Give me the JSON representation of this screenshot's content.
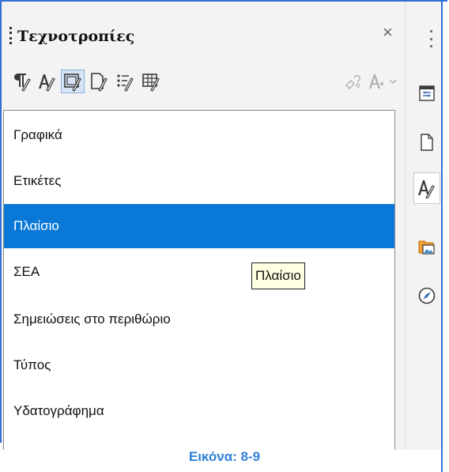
{
  "panel": {
    "title": "Τεχνοτροπίες",
    "close_label": "×"
  },
  "toolbar": {
    "buttons": [
      {
        "icon": "paragraph-styles-icon",
        "active": false
      },
      {
        "icon": "character-styles-icon",
        "active": false
      },
      {
        "icon": "frame-styles-icon",
        "active": true
      },
      {
        "icon": "page-styles-icon",
        "active": false
      },
      {
        "icon": "list-styles-icon",
        "active": false
      },
      {
        "icon": "table-styles-icon",
        "active": false
      }
    ],
    "right_buttons": [
      {
        "icon": "fill-format-mode-icon"
      },
      {
        "icon": "style-actions-icon"
      }
    ]
  },
  "list": {
    "items": [
      {
        "label": "Γραφικά",
        "selected": false
      },
      {
        "label": "Ετικέτες",
        "selected": false
      },
      {
        "label": "Πλαίσιο",
        "selected": true
      },
      {
        "label": "ΣΕΑ",
        "selected": false
      },
      {
        "label": "Σημειώσεις στο περιθώριο",
        "selected": false
      },
      {
        "label": "Τύπος",
        "selected": false
      },
      {
        "label": "Υδατογράφημα",
        "selected": false
      }
    ]
  },
  "tooltip": {
    "text": "Πλαίσιο"
  },
  "sidebar": {
    "buttons": [
      {
        "icon": "properties-icon",
        "active": false
      },
      {
        "icon": "page-icon",
        "active": false
      },
      {
        "icon": "styles-icon",
        "active": true
      },
      {
        "icon": "gallery-icon",
        "active": false
      },
      {
        "icon": "navigator-icon",
        "active": false
      }
    ]
  },
  "caption": "Εικόνα: 8-9",
  "colors": {
    "frame": "#2f6fd6",
    "selection": "#0a78d7",
    "caption": "#2f7fd6",
    "tooltip_bg": "#ffffe1"
  }
}
